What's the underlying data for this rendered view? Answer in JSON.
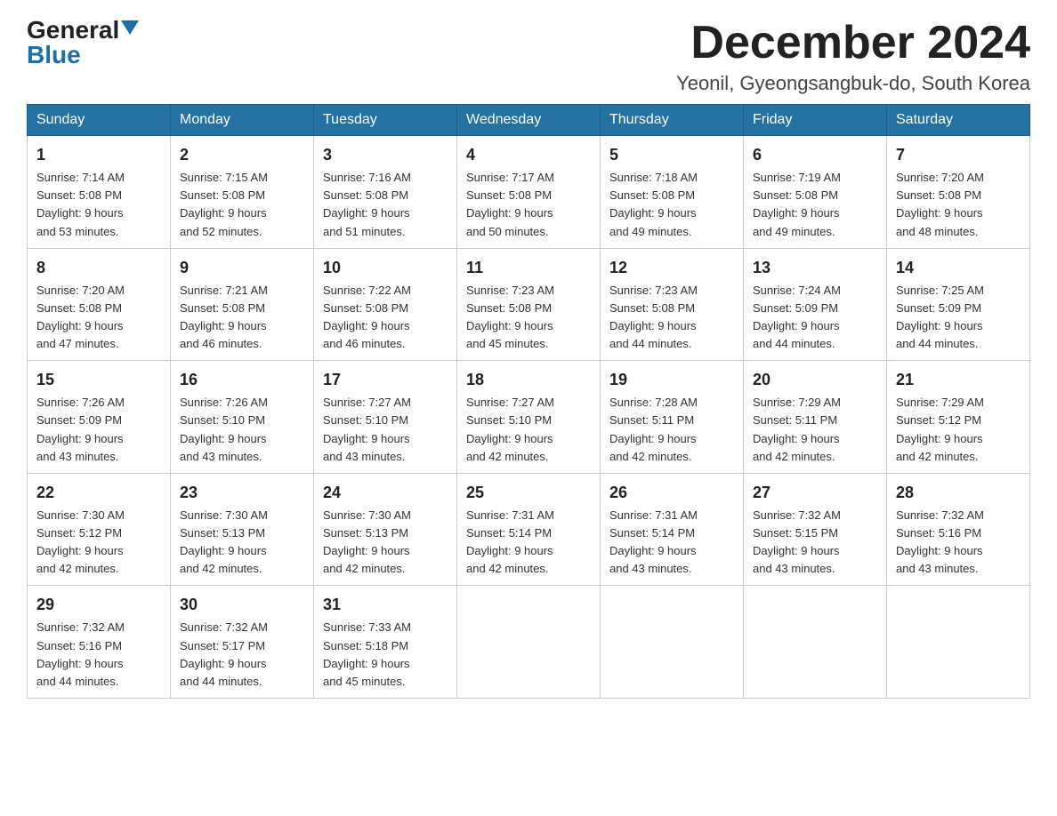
{
  "logo": {
    "general": "General",
    "blue": "Blue"
  },
  "header": {
    "month": "December 2024",
    "location": "Yeonil, Gyeongsangbuk-do, South Korea"
  },
  "days_of_week": [
    "Sunday",
    "Monday",
    "Tuesday",
    "Wednesday",
    "Thursday",
    "Friday",
    "Saturday"
  ],
  "weeks": [
    [
      {
        "day": "1",
        "sunrise": "7:14 AM",
        "sunset": "5:08 PM",
        "daylight": "9 hours and 53 minutes."
      },
      {
        "day": "2",
        "sunrise": "7:15 AM",
        "sunset": "5:08 PM",
        "daylight": "9 hours and 52 minutes."
      },
      {
        "day": "3",
        "sunrise": "7:16 AM",
        "sunset": "5:08 PM",
        "daylight": "9 hours and 51 minutes."
      },
      {
        "day": "4",
        "sunrise": "7:17 AM",
        "sunset": "5:08 PM",
        "daylight": "9 hours and 50 minutes."
      },
      {
        "day": "5",
        "sunrise": "7:18 AM",
        "sunset": "5:08 PM",
        "daylight": "9 hours and 49 minutes."
      },
      {
        "day": "6",
        "sunrise": "7:19 AM",
        "sunset": "5:08 PM",
        "daylight": "9 hours and 49 minutes."
      },
      {
        "day": "7",
        "sunrise": "7:20 AM",
        "sunset": "5:08 PM",
        "daylight": "9 hours and 48 minutes."
      }
    ],
    [
      {
        "day": "8",
        "sunrise": "7:20 AM",
        "sunset": "5:08 PM",
        "daylight": "9 hours and 47 minutes."
      },
      {
        "day": "9",
        "sunrise": "7:21 AM",
        "sunset": "5:08 PM",
        "daylight": "9 hours and 46 minutes."
      },
      {
        "day": "10",
        "sunrise": "7:22 AM",
        "sunset": "5:08 PM",
        "daylight": "9 hours and 46 minutes."
      },
      {
        "day": "11",
        "sunrise": "7:23 AM",
        "sunset": "5:08 PM",
        "daylight": "9 hours and 45 minutes."
      },
      {
        "day": "12",
        "sunrise": "7:23 AM",
        "sunset": "5:08 PM",
        "daylight": "9 hours and 44 minutes."
      },
      {
        "day": "13",
        "sunrise": "7:24 AM",
        "sunset": "5:09 PM",
        "daylight": "9 hours and 44 minutes."
      },
      {
        "day": "14",
        "sunrise": "7:25 AM",
        "sunset": "5:09 PM",
        "daylight": "9 hours and 44 minutes."
      }
    ],
    [
      {
        "day": "15",
        "sunrise": "7:26 AM",
        "sunset": "5:09 PM",
        "daylight": "9 hours and 43 minutes."
      },
      {
        "day": "16",
        "sunrise": "7:26 AM",
        "sunset": "5:10 PM",
        "daylight": "9 hours and 43 minutes."
      },
      {
        "day": "17",
        "sunrise": "7:27 AM",
        "sunset": "5:10 PM",
        "daylight": "9 hours and 43 minutes."
      },
      {
        "day": "18",
        "sunrise": "7:27 AM",
        "sunset": "5:10 PM",
        "daylight": "9 hours and 42 minutes."
      },
      {
        "day": "19",
        "sunrise": "7:28 AM",
        "sunset": "5:11 PM",
        "daylight": "9 hours and 42 minutes."
      },
      {
        "day": "20",
        "sunrise": "7:29 AM",
        "sunset": "5:11 PM",
        "daylight": "9 hours and 42 minutes."
      },
      {
        "day": "21",
        "sunrise": "7:29 AM",
        "sunset": "5:12 PM",
        "daylight": "9 hours and 42 minutes."
      }
    ],
    [
      {
        "day": "22",
        "sunrise": "7:30 AM",
        "sunset": "5:12 PM",
        "daylight": "9 hours and 42 minutes."
      },
      {
        "day": "23",
        "sunrise": "7:30 AM",
        "sunset": "5:13 PM",
        "daylight": "9 hours and 42 minutes."
      },
      {
        "day": "24",
        "sunrise": "7:30 AM",
        "sunset": "5:13 PM",
        "daylight": "9 hours and 42 minutes."
      },
      {
        "day": "25",
        "sunrise": "7:31 AM",
        "sunset": "5:14 PM",
        "daylight": "9 hours and 42 minutes."
      },
      {
        "day": "26",
        "sunrise": "7:31 AM",
        "sunset": "5:14 PM",
        "daylight": "9 hours and 43 minutes."
      },
      {
        "day": "27",
        "sunrise": "7:32 AM",
        "sunset": "5:15 PM",
        "daylight": "9 hours and 43 minutes."
      },
      {
        "day": "28",
        "sunrise": "7:32 AM",
        "sunset": "5:16 PM",
        "daylight": "9 hours and 43 minutes."
      }
    ],
    [
      {
        "day": "29",
        "sunrise": "7:32 AM",
        "sunset": "5:16 PM",
        "daylight": "9 hours and 44 minutes."
      },
      {
        "day": "30",
        "sunrise": "7:32 AM",
        "sunset": "5:17 PM",
        "daylight": "9 hours and 44 minutes."
      },
      {
        "day": "31",
        "sunrise": "7:33 AM",
        "sunset": "5:18 PM",
        "daylight": "9 hours and 45 minutes."
      },
      null,
      null,
      null,
      null
    ]
  ],
  "labels": {
    "sunrise": "Sunrise:",
    "sunset": "Sunset:",
    "daylight": "Daylight:"
  }
}
